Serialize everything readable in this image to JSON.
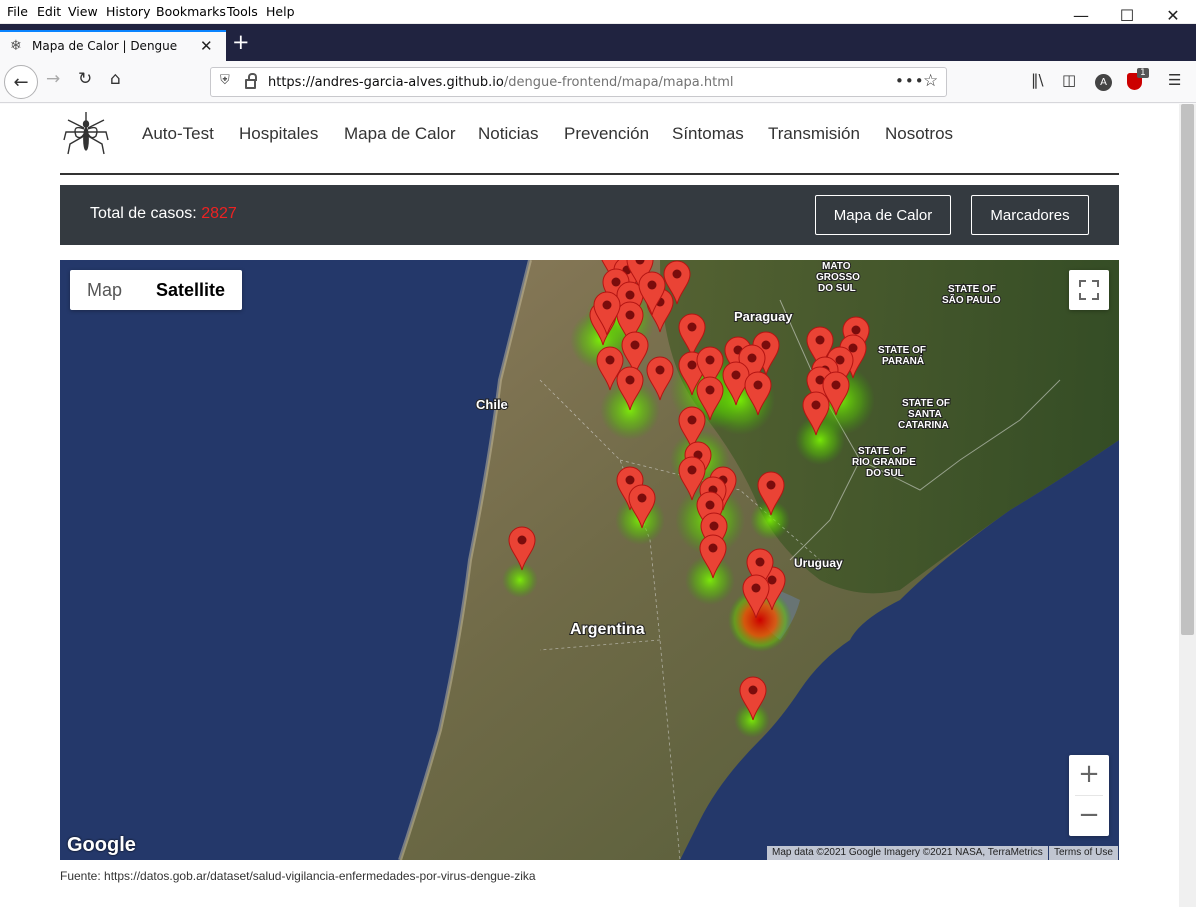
{
  "menubar": {
    "items": [
      "File",
      "Edit",
      "View",
      "History",
      "Bookmarks",
      "Tools",
      "Help"
    ]
  },
  "tab": {
    "title": "Mapa de Calor | Dengue"
  },
  "urlbar": {
    "domain": "https://andres-garcia-alves.github.io",
    "path": "/dengue-frontend/mapa/mapa.html"
  },
  "toolbar": {
    "badge": "1",
    "account_letter": "A"
  },
  "site_nav": {
    "items": [
      "Auto-Test",
      "Hospitales",
      "Mapa de Calor",
      "Noticias",
      "Prevención",
      "Síntomas",
      "Transmisión",
      "Nosotros"
    ]
  },
  "stats": {
    "label": "Total de casos:",
    "count": "2827",
    "btn_heatmap": "Mapa de Calor",
    "btn_markers": "Marcadores"
  },
  "map": {
    "type_map": "Map",
    "type_satellite": "Satellite",
    "zoom_in": "+",
    "zoom_out": "−",
    "google": "Google",
    "attribution": "Map data ©2021 Google Imagery ©2021 NASA, TerraMetrics",
    "terms": "Terms of Use",
    "labels": {
      "paraguay": "Paraguay",
      "chile": "Chile",
      "argentina": "Argentina",
      "uruguay": "Uruguay",
      "mato1": "MATO",
      "mato2": "GROSSO",
      "mato3": "DO SUL",
      "sp1": "STATE OF",
      "sp2": "SÃO PAULO",
      "pr1": "STATE OF",
      "pr2": "PARANÁ",
      "sc1": "STATE OF",
      "sc2": "SANTA",
      "sc3": "CATARINA",
      "rs1": "STATE OF",
      "rs2": "RIO GRANDE",
      "rs3": "DO SUL"
    }
  },
  "footer": {
    "source": "Fuente: https://datos.gob.ar/dataset/salud-vigilancia-enfermedades-por-virus-dengue-zika"
  }
}
